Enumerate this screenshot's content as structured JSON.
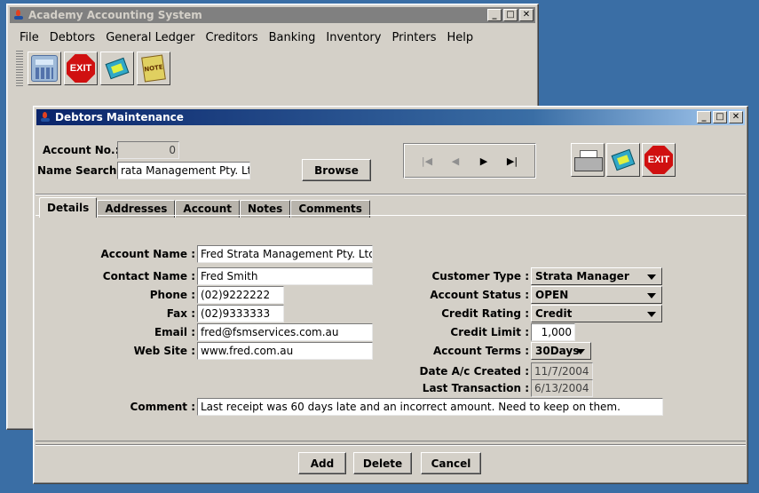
{
  "main_window": {
    "title": "Academy Accounting System",
    "menu": [
      "File",
      "Debtors",
      "General Ledger",
      "Creditors",
      "Banking",
      "Inventory",
      "Printers",
      "Help"
    ],
    "toolbar_exit_label": "EXIT",
    "toolbar_note_label": "NOTE"
  },
  "dialog": {
    "title": "Debtors Maintenance",
    "account_no_label": "Account No.:",
    "account_no_value": "0",
    "name_search_label": "Name Search :",
    "name_search_value": "rata Management Pty. Ltd.",
    "browse_label": "Browse",
    "nav": {
      "first": "|◀",
      "prev": "◀",
      "next": "▶",
      "last": "▶|"
    },
    "exit_label": "EXIT",
    "tabs": [
      "Details",
      "Addresses",
      "Account",
      "Notes",
      "Comments"
    ],
    "details": {
      "account_name_label": "Account Name :",
      "account_name": "Fred Strata Management Pty. Ltd.",
      "contact_name_label": "Contact Name :",
      "contact_name": "Fred Smith",
      "phone_label": "Phone :",
      "phone": "(02)9222222",
      "fax_label": "Fax :",
      "fax": "(02)9333333",
      "email_label": "Email :",
      "email": "fred@fsmservices.com.au",
      "website_label": "Web Site :",
      "website": "www.fred.com.au",
      "customer_type_label": "Customer Type :",
      "customer_type": "Strata Manager",
      "account_status_label": "Account Status :",
      "account_status": "OPEN",
      "credit_rating_label": "Credit Rating :",
      "credit_rating": "Credit",
      "credit_limit_label": "Credit Limit :",
      "credit_limit": "1,000",
      "account_terms_label": "Account Terms :",
      "account_terms": "30Days",
      "date_created_label": "Date A/c Created :",
      "date_created": "11/7/2004",
      "last_transaction_label": "Last Transaction :",
      "last_transaction": "6/13/2004",
      "comment_label": "Comment :",
      "comment": "Last receipt was 60 days late and an incorrect amount. Need to keep on them."
    },
    "buttons": {
      "add": "Add",
      "delete": "Delete",
      "cancel": "Cancel"
    }
  }
}
